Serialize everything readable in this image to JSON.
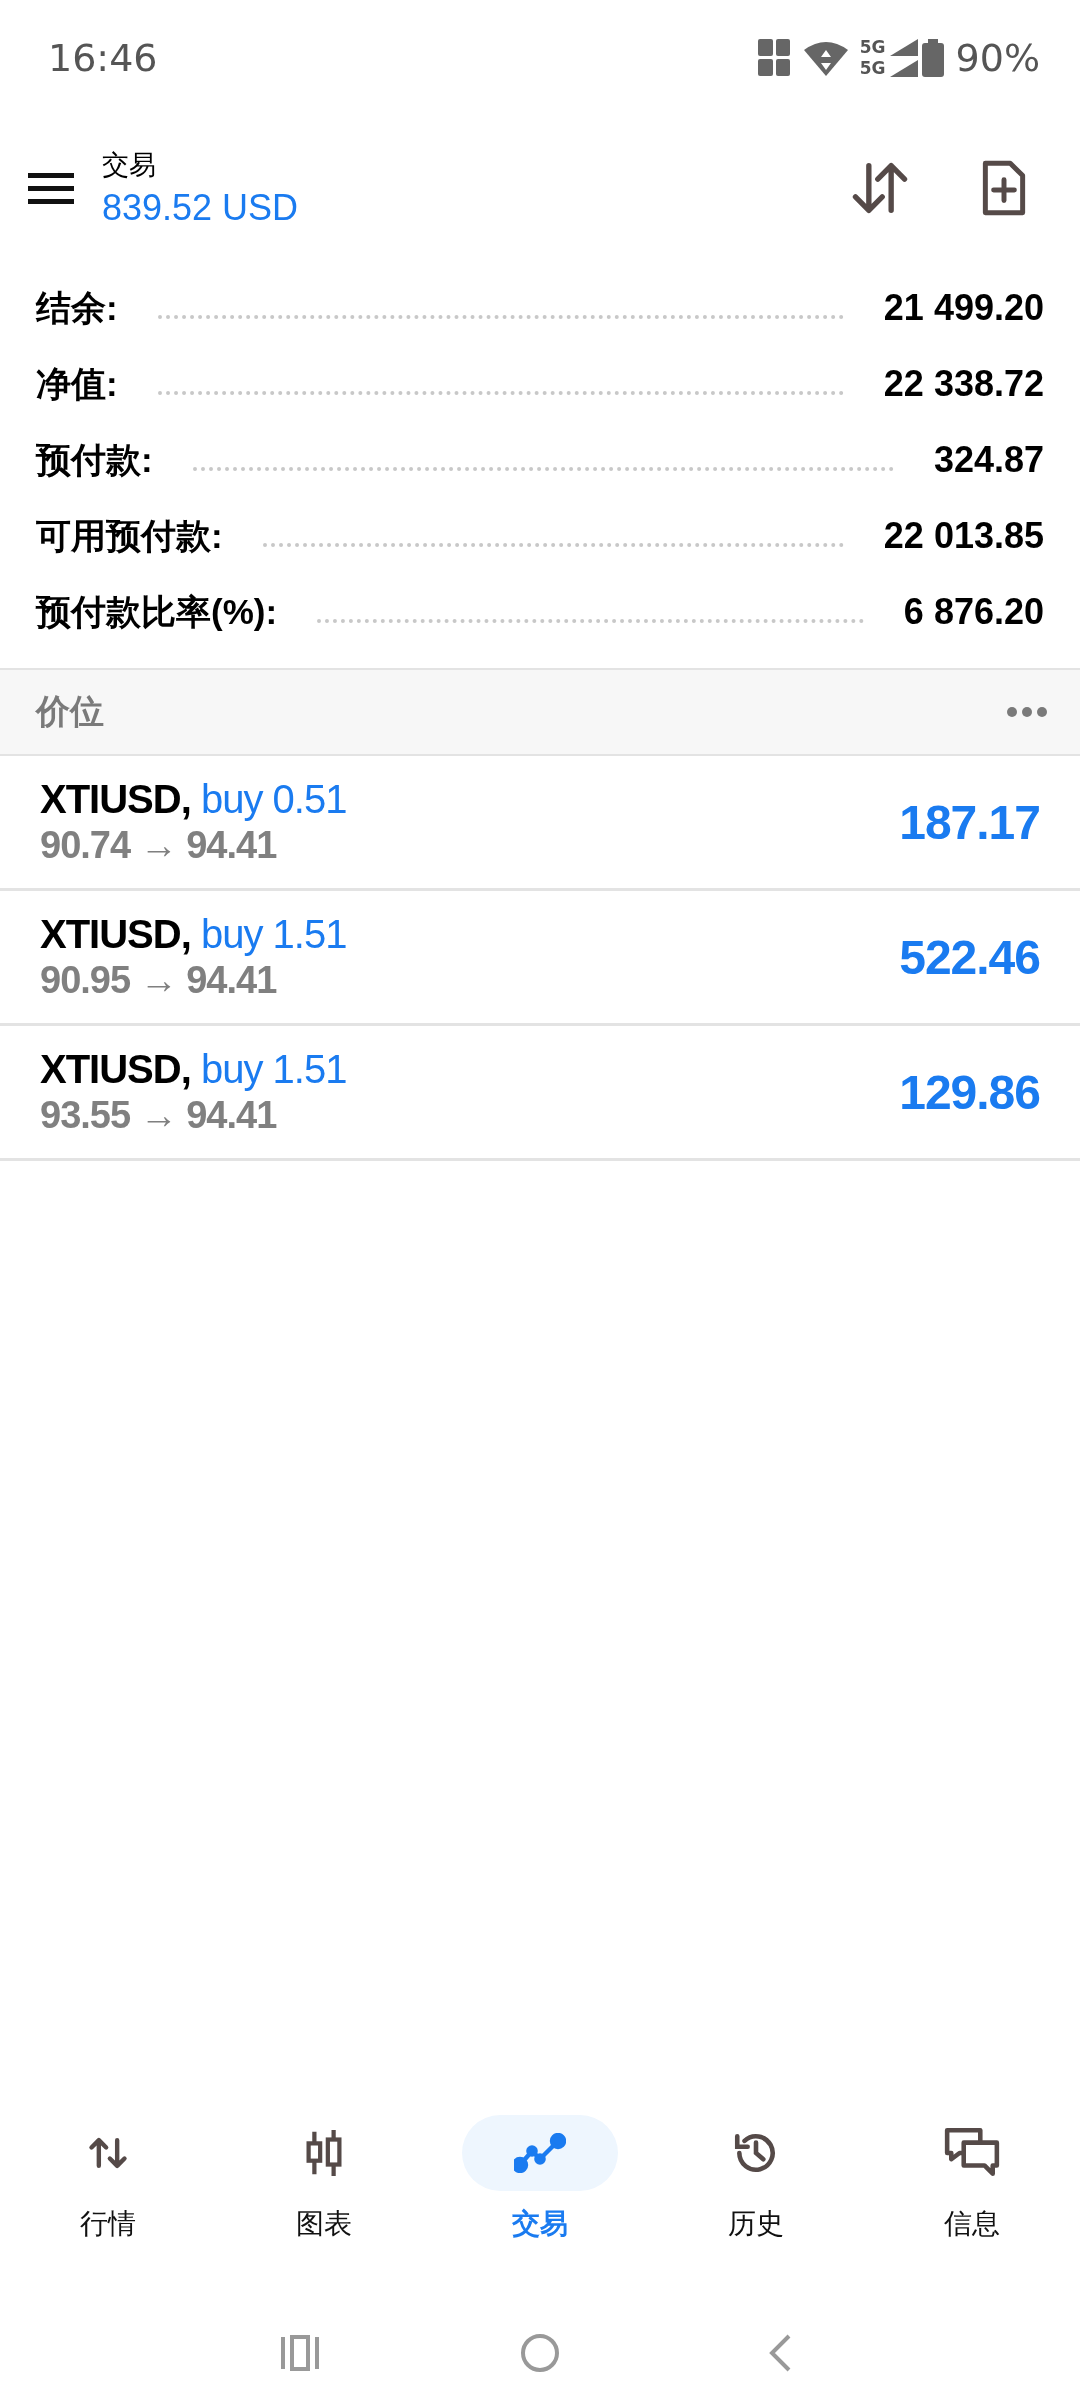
{
  "status_bar": {
    "time": "16:46",
    "network": [
      "5G",
      "5G"
    ],
    "battery": "90%"
  },
  "header": {
    "title": "交易",
    "balance": "839.52 USD"
  },
  "summary": [
    {
      "label": "结余:",
      "value": "21 499.20"
    },
    {
      "label": "净值:",
      "value": "22 338.72"
    },
    {
      "label": "预付款:",
      "value": "324.87"
    },
    {
      "label": "可用预付款:",
      "value": "22 013.85"
    },
    {
      "label": "预付款比率(%):",
      "value": "6 876.20"
    }
  ],
  "positions_section": {
    "title": "价位"
  },
  "positions": [
    {
      "symbol": "XTIUSD,",
      "side": "buy 0.51",
      "prices": "90.74 → 94.41",
      "profit": "187.17"
    },
    {
      "symbol": "XTIUSD,",
      "side": "buy 1.51",
      "prices": "90.95 → 94.41",
      "profit": "522.46"
    },
    {
      "symbol": "XTIUSD,",
      "side": "buy 1.51",
      "prices": "93.55 → 94.41",
      "profit": "129.86"
    }
  ],
  "bottom_nav": [
    {
      "label": "行情",
      "kind": "quotes",
      "selected": false
    },
    {
      "label": "图表",
      "kind": "chart",
      "selected": false
    },
    {
      "label": "交易",
      "kind": "trade",
      "selected": true
    },
    {
      "label": "历史",
      "kind": "history",
      "selected": false
    },
    {
      "label": "信息",
      "kind": "messages",
      "selected": false
    }
  ]
}
